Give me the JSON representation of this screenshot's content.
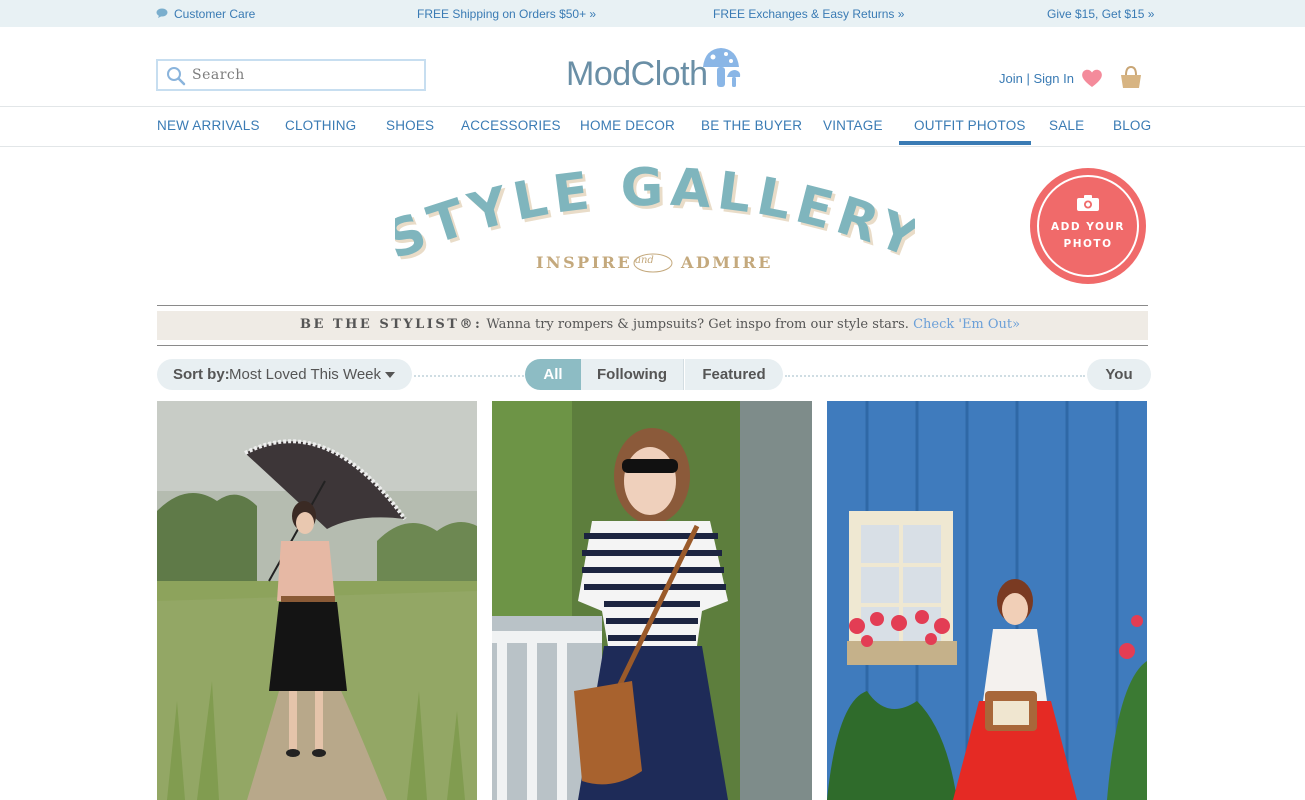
{
  "promo_bar": {
    "customer_care": "Customer Care",
    "shipping": "FREE Shipping on Orders $50+ »",
    "exchanges": "FREE Exchanges & Easy Returns »",
    "give": "Give $15, Get $15 »"
  },
  "header": {
    "search_placeholder": "Search",
    "logo_text": "ModCloth",
    "account": "Join | Sign In"
  },
  "nav": {
    "items": [
      "NEW ARRIVALS",
      "CLOTHING",
      "SHOES",
      "ACCESSORIES",
      "HOME DECOR",
      "BE THE BUYER",
      "VINTAGE",
      "OUTFIT PHOTOS",
      "SALE",
      "BLOG"
    ],
    "active": "OUTFIT PHOTOS"
  },
  "gallery": {
    "title": "STYLE GALLERY",
    "sub_left": "INSPIRE",
    "sub_and": "and",
    "sub_right": "ADMIRE",
    "badge": "ADD YOUR\nPHOTO"
  },
  "banner": {
    "lead": "BE THE STYLIST®:",
    "text": " Wanna try rompers & jumpsuits? Get inspo from our style stars. ",
    "link": "Check 'Em Out»"
  },
  "filters": {
    "sort_label": "Sort by:",
    "sort_value": "Most Loved This Week",
    "tabs": [
      "All",
      "Following",
      "Featured"
    ],
    "active_tab": "All",
    "you": "You"
  },
  "colors": {
    "link_blue": "#3a7bb4",
    "teal": "#8dbcc4",
    "badge_coral": "#f06a6a",
    "tan": "#c4a97d"
  },
  "icons": {
    "care": "speech-bubble-icon",
    "search": "magnifier-icon",
    "heart": "heart-icon",
    "bag": "shopping-bag-icon",
    "camera": "camera-icon"
  }
}
